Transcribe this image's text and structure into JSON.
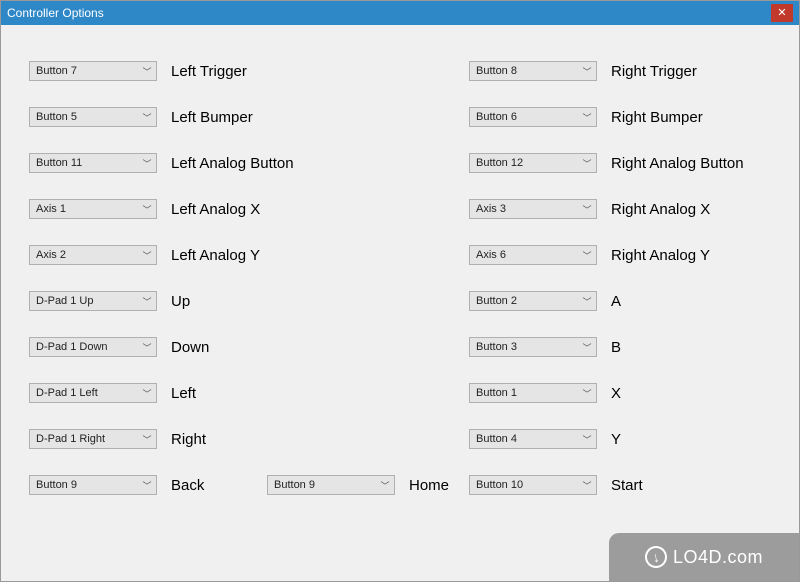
{
  "window": {
    "title": "Controller Options"
  },
  "rows": [
    {
      "left": {
        "value": "Button 7",
        "label": "Left Trigger"
      },
      "right": {
        "value": "Button 8",
        "label": "Right Trigger"
      }
    },
    {
      "left": {
        "value": "Button 5",
        "label": "Left Bumper"
      },
      "right": {
        "value": "Button 6",
        "label": "Right Bumper"
      }
    },
    {
      "left": {
        "value": "Button 11",
        "label": "Left Analog Button"
      },
      "right": {
        "value": "Button 12",
        "label": "Right Analog Button"
      }
    },
    {
      "left": {
        "value": "Axis 1",
        "label": "Left Analog X"
      },
      "right": {
        "value": "Axis 3",
        "label": "Right Analog X"
      }
    },
    {
      "left": {
        "value": "Axis 2",
        "label": "Left Analog Y"
      },
      "right": {
        "value": "Axis 6",
        "label": "Right Analog Y"
      }
    },
    {
      "left": {
        "value": "D-Pad 1 Up",
        "label": "Up"
      },
      "right": {
        "value": "Button 2",
        "label": "A"
      }
    },
    {
      "left": {
        "value": "D-Pad 1 Down",
        "label": "Down"
      },
      "right": {
        "value": "Button 3",
        "label": "B"
      }
    },
    {
      "left": {
        "value": "D-Pad 1 Left",
        "label": "Left"
      },
      "right": {
        "value": "Button 1",
        "label": "X"
      }
    },
    {
      "left": {
        "value": "D-Pad 1 Right",
        "label": "Right"
      },
      "right": {
        "value": "Button 4",
        "label": "Y"
      }
    }
  ],
  "bottom": {
    "back": {
      "value": "Button 9",
      "label": "Back"
    },
    "home": {
      "value": "Button 9",
      "label": "Home"
    },
    "start": {
      "value": "Button 10",
      "label": "Start"
    }
  },
  "watermark": "LO4D.com"
}
